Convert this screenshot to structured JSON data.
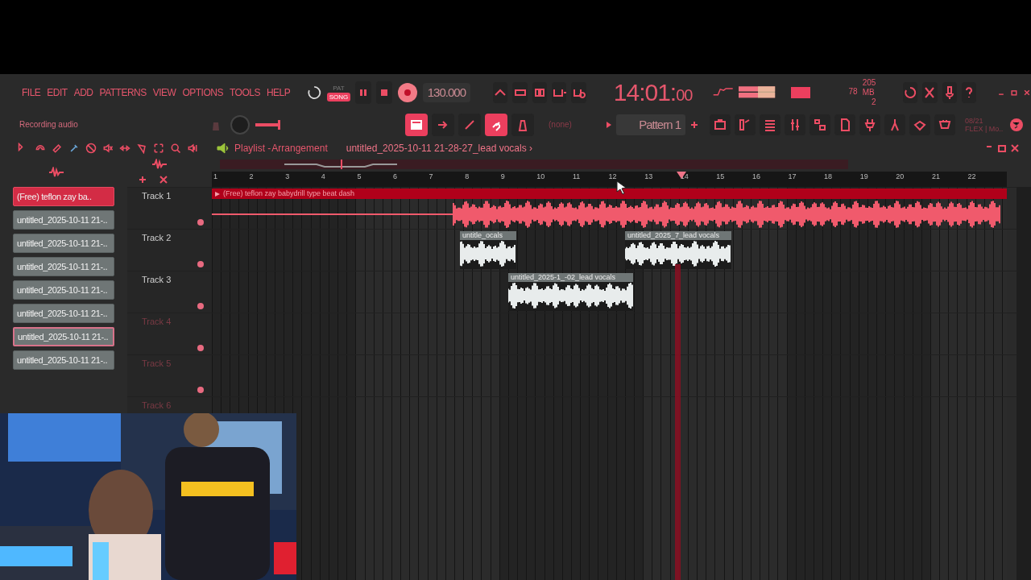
{
  "menu": [
    "FILE",
    "EDIT",
    "ADD",
    "PATTERNS",
    "VIEW",
    "OPTIONS",
    "TOOLS",
    "HELP"
  ],
  "mode_toggle": [
    {
      "label": "PAT",
      "selected": false
    },
    {
      "label": "SONG",
      "selected": true
    }
  ],
  "record": {
    "on": true
  },
  "tempo": "130.000",
  "time": {
    "main": "14:01:",
    "sub": "00"
  },
  "cpu": "78",
  "memory": "205 MB",
  "polyphony": "2",
  "hint": "Recording audio",
  "snap_buttons": [
    {
      "on": true
    },
    {
      "on": false
    },
    {
      "on": false
    },
    {
      "on": true
    },
    {
      "on": false
    }
  ],
  "pattern_source": "(none)",
  "pattern": "Pattern 1",
  "info": [
    "08/21",
    "FLEX | Mo.."
  ],
  "playlist": {
    "title": "Playlist - ",
    "subtitle": "Arrangement",
    "file": "untitled_2025-10-11 21-28-27_lead vocals ›",
    "ruler": [
      "1",
      "2",
      "3",
      "4",
      "5",
      "6",
      "7",
      "8",
      "9",
      "10",
      "11",
      "12",
      "13",
      "14",
      "15",
      "16",
      "17",
      "18",
      "19",
      "20",
      "21",
      "22"
    ],
    "channels": [
      {
        "label": "(Free) teflon zay  ba..",
        "kind": "beat",
        "selected": false
      },
      {
        "label": "untitled_2025-10-11 21-..",
        "kind": "vocal",
        "selected": false
      },
      {
        "label": "untitled_2025-10-11 21-..",
        "kind": "vocal",
        "selected": false
      },
      {
        "label": "untitled_2025-10-11 21-..",
        "kind": "vocal",
        "selected": false
      },
      {
        "label": "untitled_2025-10-11 21-..",
        "kind": "vocal",
        "selected": false
      },
      {
        "label": "untitled_2025-10-11 21-..",
        "kind": "vocal",
        "selected": false
      },
      {
        "label": "untitled_2025-10-11 21-..",
        "kind": "vocal",
        "selected": true
      },
      {
        "label": "untitled_2025-10-11 21-..",
        "kind": "vocal",
        "selected": false
      }
    ],
    "tracks": [
      {
        "name": "Track 1",
        "empty": false,
        "clips": [
          {
            "label": "(Free) teflon zay  babydrill type beat dash",
            "kind": "beat"
          }
        ]
      },
      {
        "name": "Track 2",
        "empty": false,
        "clips": [
          {
            "label": "untitle_ocals",
            "kind": "vocal"
          },
          {
            "label": "untitled_2025_7_lead vocals",
            "kind": "vocal"
          }
        ]
      },
      {
        "name": "Track 3",
        "empty": false,
        "clips": [
          {
            "label": "untitled_2025-1_-02_lead vocals",
            "kind": "vocal"
          }
        ]
      },
      {
        "name": "Track 4",
        "empty": true
      },
      {
        "name": "Track 5",
        "empty": true
      },
      {
        "name": "Track 6",
        "empty": true
      }
    ]
  }
}
